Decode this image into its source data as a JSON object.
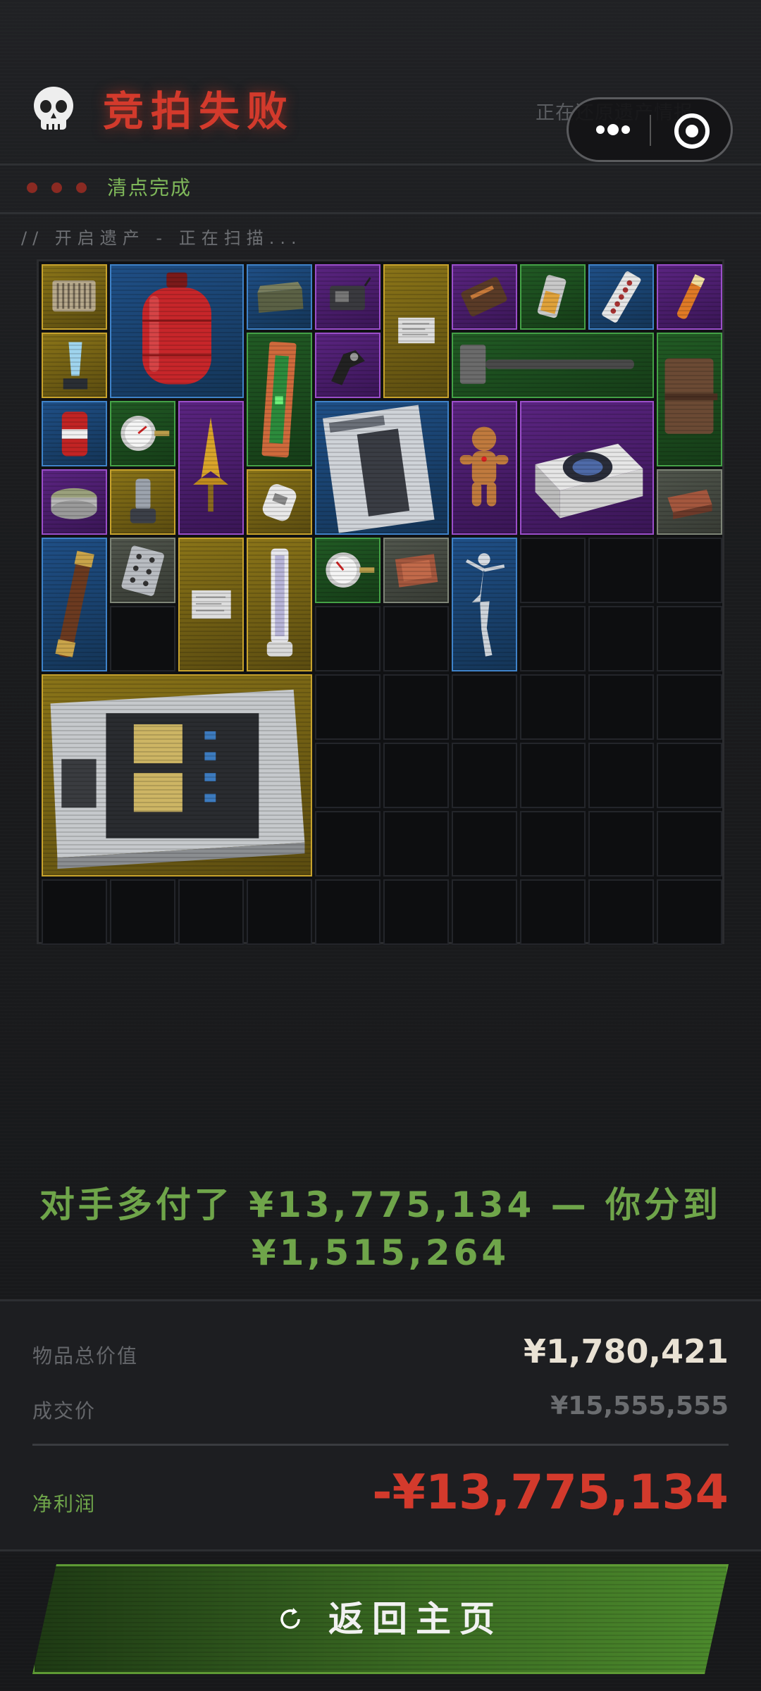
{
  "header": {
    "title": "竞拍失败",
    "status_hint": "正在还原遗产情报"
  },
  "capsule": {
    "more_icon": "more-dots-icon",
    "close_icon": "target-circle-icon"
  },
  "substatus": {
    "label": "清点完成"
  },
  "scan_line": "// 开启遗产 - 正在扫描...",
  "inventory": {
    "items": [
      {
        "name": "circuit-board-item",
        "rarity": "gold"
      },
      {
        "name": "gas-cylinder-item",
        "rarity": "blue"
      },
      {
        "name": "ammo-tin-item",
        "rarity": "blue"
      },
      {
        "name": "gadget-board-item",
        "rarity": "purple"
      },
      {
        "name": "document-item",
        "rarity": "gold"
      },
      {
        "name": "wallet-item",
        "rarity": "purple"
      },
      {
        "name": "lighter-item",
        "rarity": "green"
      },
      {
        "name": "pill-strip-item",
        "rarity": "blue"
      },
      {
        "name": "vial-item",
        "rarity": "purple"
      },
      {
        "name": "crystal-trophy-item",
        "rarity": "gold"
      },
      {
        "name": "signal-device-item",
        "rarity": "green"
      },
      {
        "name": "clamp-item",
        "rarity": "purple"
      },
      {
        "name": "sledgehammer-item",
        "rarity": "green"
      },
      {
        "name": "leather-notebook-item",
        "rarity": "green"
      },
      {
        "name": "cola-can-item",
        "rarity": "blue"
      },
      {
        "name": "pressure-gauge-item",
        "rarity": "green"
      },
      {
        "name": "golden-spire-item",
        "rarity": "purple"
      },
      {
        "name": "magazine-item",
        "rarity": "blue"
      },
      {
        "name": "gingerbread-item",
        "rarity": "purple"
      },
      {
        "name": "centrifuge-item",
        "rarity": "purple"
      },
      {
        "name": "tobacco-tin-item",
        "rarity": "purple"
      },
      {
        "name": "inhaler-item",
        "rarity": "gold"
      },
      {
        "name": "sensor-item",
        "rarity": "gold"
      },
      {
        "name": "matchbox-item",
        "rarity": "gray"
      },
      {
        "name": "telescope-item",
        "rarity": "blue"
      },
      {
        "name": "playing-card-item",
        "rarity": "gray"
      },
      {
        "name": "document-item-2",
        "rarity": "gold"
      },
      {
        "name": "glass-tube-item",
        "rarity": "gold"
      },
      {
        "name": "pressure-gauge-item-2",
        "rarity": "green"
      },
      {
        "name": "matchbox-item-2",
        "rarity": "gray"
      },
      {
        "name": "ballerina-statue-item",
        "rarity": "blue"
      },
      {
        "name": "server-rack-item",
        "rarity": "gold"
      }
    ]
  },
  "message": {
    "line1": "对手多付了 ¥13,775,134 — 你分到",
    "line2": "¥1,515,264"
  },
  "summary": {
    "total_value_label": "物品总价值",
    "total_value": "¥1,780,421",
    "deal_price_label": "成交价",
    "deal_price": "¥15,555,555",
    "net_profit_label": "净利润",
    "net_profit": "-¥13,775,134"
  },
  "home_button": {
    "label": "返回主页",
    "icon": "reload-icon"
  },
  "colors": {
    "fail_red": "#d33a2c",
    "success_green": "#6fa54a",
    "gold": "#c7a22c",
    "blue": "#3f82c8",
    "purple": "#9a4ec9",
    "green": "#44a146"
  }
}
